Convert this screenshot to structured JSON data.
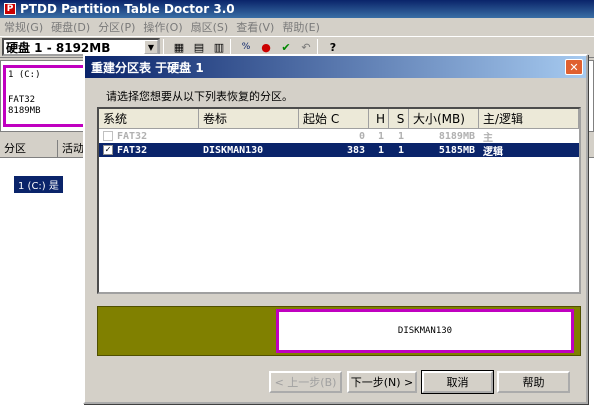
{
  "app": {
    "title": "PTDD Partition Table Doctor 3.0",
    "app_icon": "P"
  },
  "menu": [
    "常规(G)",
    "硬盘(D)",
    "分区(P)",
    "操作(O)",
    "扇区(S)",
    "查看(V)",
    "帮助(E)"
  ],
  "toolbar": {
    "disk_selected": "硬盘 1 - 8192MB",
    "icons": [
      "copy-icon",
      "save-icon",
      "restore-icon",
      "record-icon",
      "check-icon",
      "undo-icon",
      "help-icon"
    ]
  },
  "diskmap": {
    "line1": "1 (C:)",
    "line2": "FAT32",
    "line3": "8189MB"
  },
  "background_list": {
    "col1": "分区",
    "col2": "活动",
    "row": "1 (C:) 是"
  },
  "dialog": {
    "title": "重建分区表 于硬盘 1",
    "close": "✕",
    "prompt": "请选择您想要从以下列表恢复的分区。",
    "columns": {
      "system": "系统",
      "volume": "卷标",
      "start": "起始 C",
      "h": "H",
      "s": "S",
      "size": "大小(MB)",
      "type": "主/逻辑"
    },
    "rows": [
      {
        "checked": "",
        "system": "FAT32",
        "volume": "",
        "c": "0",
        "h": "1",
        "s": "1",
        "size": "8189MB",
        "type": "主"
      },
      {
        "checked": "✓",
        "system": "FAT32",
        "volume": "DISKMAN130",
        "c": "383",
        "h": "1",
        "s": "1",
        "size": "5185MB",
        "type": "逻辑"
      }
    ],
    "preview_label": "DISKMAN130",
    "buttons": {
      "back": "< 上一步(B)",
      "next": "下一步(N) >",
      "cancel": "取消",
      "help": "帮助"
    }
  },
  "colors": {
    "title_blue": "#0a246a",
    "partition_magenta": "#c000c0",
    "preview_olive": "#808000"
  }
}
